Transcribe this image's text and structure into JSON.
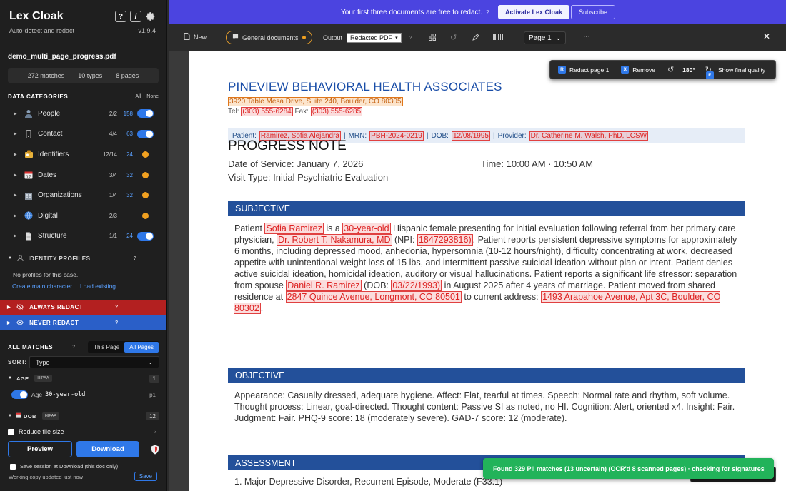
{
  "sidebar": {
    "app_title": "Lex Cloak",
    "app_subtitle": "Auto-detect and redact",
    "help_button": "?",
    "info_button": "i",
    "version": "v1.9.4",
    "filename": "demo_multi_page_progress.pdf",
    "stats": {
      "matches": "272 matches",
      "types": "10 types",
      "pages": "8 pages",
      "sep": "·"
    },
    "categories_title": "DATA CATEGORIES",
    "all_label": "All",
    "none_label": "None",
    "categories": [
      {
        "label": "People",
        "ratio": "2/2",
        "count": "158",
        "state": "on",
        "icon": "person-icon"
      },
      {
        "label": "Contact",
        "ratio": "4/4",
        "count": "63",
        "state": "on",
        "icon": "phone-icon"
      },
      {
        "label": "Identifiers",
        "ratio": "12/14",
        "count": "24",
        "state": "partial",
        "icon": "id-icon"
      },
      {
        "label": "Dates",
        "ratio": "3/4",
        "count": "32",
        "state": "partial",
        "icon": "calendar-icon"
      },
      {
        "label": "Organizations",
        "ratio": "1/4",
        "count": "32",
        "state": "partial",
        "icon": "building-icon"
      },
      {
        "label": "Digital",
        "ratio": "2/3",
        "count": "",
        "state": "partial",
        "icon": "globe-icon"
      },
      {
        "label": "Structure",
        "ratio": "1/1",
        "count": "24",
        "state": "on",
        "icon": "document-icon"
      }
    ],
    "profiles_title": "IDENTITY PROFILES",
    "profiles_empty": "No profiles for this case.",
    "create_main": "Create main character",
    "link_sep": "·",
    "load_existing": "Load existing...",
    "always_redact": "ALWAYS REDACT",
    "never_redact": "NEVER REDACT",
    "q": "?",
    "all_matches_title": "ALL MATCHES",
    "this_page": "This Page",
    "all_pages": "All Pages",
    "sort_label": "SORT:",
    "sort_value": "Type",
    "groups": [
      {
        "name": "AGE",
        "tag": "HIPAA",
        "count": "1"
      },
      {
        "name": "DOB",
        "tag": "HIPAA",
        "count": "12"
      }
    ],
    "item": {
      "label": "Age",
      "value": "30-year-old",
      "page": "p1"
    },
    "reduce_file_size": "Reduce file size",
    "preview": "Preview",
    "download": "Download",
    "save_session": "Save session at Download (this doc only)",
    "working_copy": "Working copy updated just now",
    "save": "Save"
  },
  "banner": {
    "text": "Your first three documents are free to redact.",
    "q": "?",
    "activate": "Activate Lex Cloak",
    "subscribe": "Subscribe"
  },
  "toolbar": {
    "new_label": "New",
    "preset": "General documents",
    "output_label": "Output",
    "output_value": "Redacted PDF",
    "q": "?",
    "page_label": "Page 1",
    "more": "···"
  },
  "floating": {
    "redact_key": "R",
    "redact_page": "Redact page 1",
    "remove_key": "X",
    "remove": "Remove",
    "rotation": "180°",
    "final_key": "F",
    "show_final": "Show final quality"
  },
  "toast": "Found 329 PII matches (13 uncertain) (OCR'd 8 scanned pages) · checking for signatures",
  "document": {
    "clinic": "PINEVIEW BEHAVIORAL HEALTH ASSOCIATES",
    "address": "3920 Table Mesa Drive, Suite 240, Boulder, CO 80305",
    "tel_label": "Tel:",
    "tel": "(303) 555-6284",
    "fax_label": "Fax:",
    "fax": "(303) 555-6285",
    "patient_label": "Patient:",
    "patient": "Ramirez, Sofia Alejandra",
    "mrn_label": "MRN:",
    "mrn": "PBH-2024-0219",
    "dob_label": "DOB:",
    "dob": "12/08/1995",
    "provider_label": "Provider:",
    "provider": "Dr. Catherine M. Walsh, PhD, LCSW",
    "bar": "|",
    "note_title": "PROGRESS NOTE",
    "date_of_service": "Date of Service: January 7, 2026",
    "time": "Time: 10:00 AM · 10:50 AM",
    "visit_type": "Visit Type: Initial Psychiatric Evaluation",
    "subjective": "SUBJECTIVE",
    "subj": {
      "t1": "Patient ",
      "r1": "Sofia Ramirez",
      "t2": " is a ",
      "r2": "30-year-old",
      "t3": " Hispanic female presenting for initial evaluation following referral from her primary care physician, ",
      "r3": "Dr. Robert T. Nakamura, MD",
      "t4": " (NPI: ",
      "r4": "1847293816)",
      "t5": ". Patient reports persistent depressive symptoms for approximately 6 months, including depressed mood, anhedonia, hypersomnia (10-12 hours/night), difficulty concentrating at work, decreased appetite with unintentional weight loss of 15 lbs, and intermittent passive suicidal ideation without plan or intent. Patient denies active suicidal ideation, homicidal ideation, auditory or visual hallucinations. Patient reports a significant life stressor: separation from spouse ",
      "r5": "Daniel R. Ramirez",
      "t6": " (DOB: ",
      "r6": "03/22/1993)",
      "t7": " in August 2025 after 4 years of marriage. Patient moved from shared residence at ",
      "r7": "2847 Quince Avenue, Longmont, CO 80501",
      "t8": " to current address: ",
      "r8": "1493 Arapahoe Avenue, Apt 3C, Boulder, CO 80302",
      "t9": "."
    },
    "objective": "OBJECTIVE",
    "obj_text": "Appearance: Casually dressed, adequate hygiene. Affect: Flat, tearful at times. Speech: Normal rate and rhythm, soft volume. Thought process: Linear, goal-directed. Thought content: Passive SI as noted, no HI. Cognition: Alert, oriented x4. Insight: Fair. Judgment: Fair. PHQ-9 score: 18 (moderately severe). GAD-7 score: 12 (moderate).",
    "assessment": "ASSESSMENT",
    "dx1": "1. Major Depressive Disorder, Recurrent Episode, Moderate (F33.1)"
  }
}
